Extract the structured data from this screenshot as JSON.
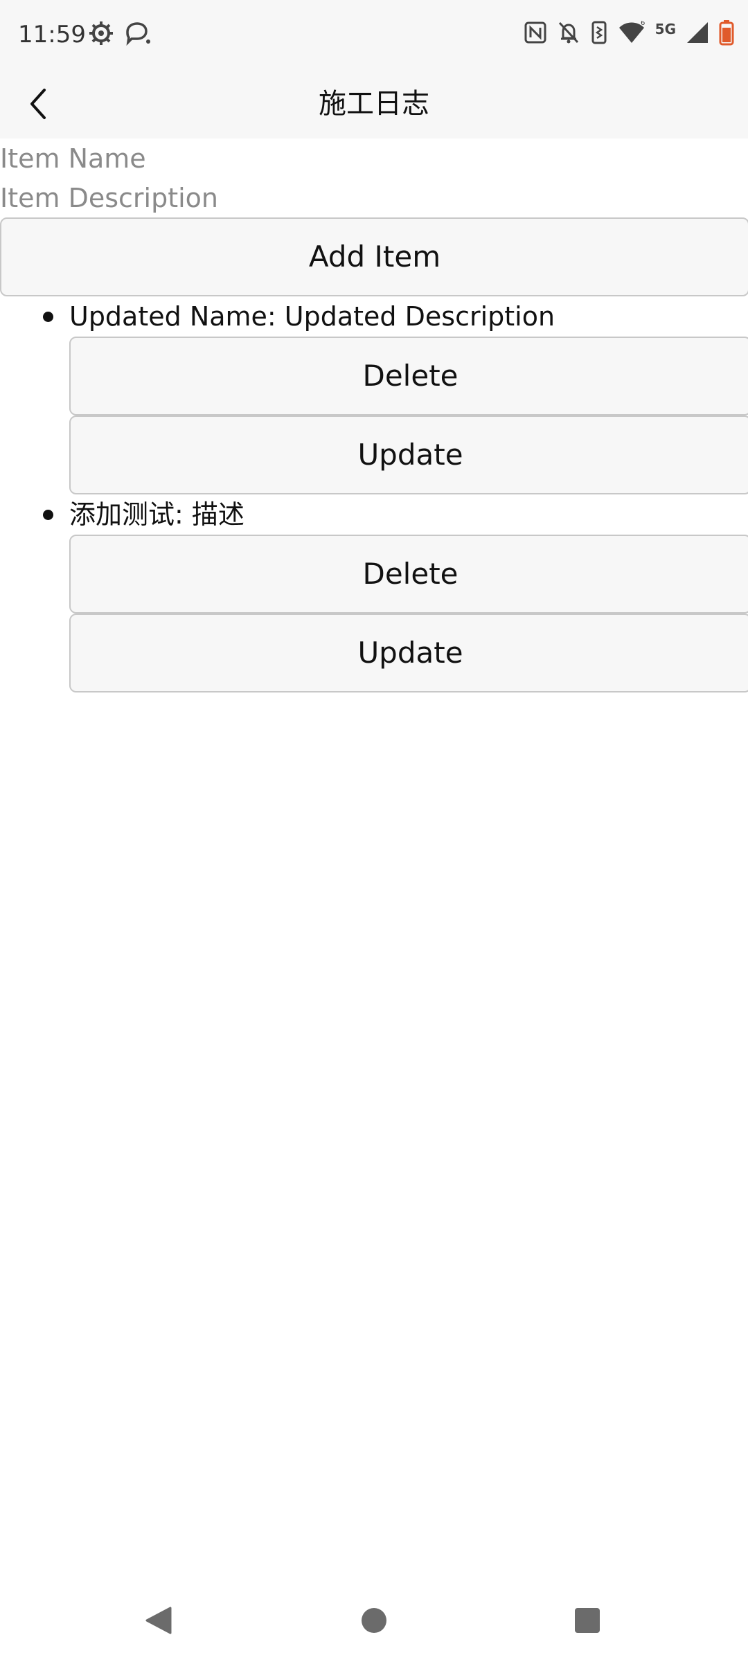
{
  "status_bar": {
    "time": "11:59",
    "network_label": "5G",
    "left_icons": [
      "settings-icon",
      "chat-bubble-icon"
    ],
    "right_icons": [
      "nfc-icon",
      "bell-off-icon",
      "vibrate-icon",
      "wifi-icon",
      "signal-icon",
      "battery-icon"
    ],
    "battery_color": "#e05a2b"
  },
  "app_bar": {
    "title": "施工日志",
    "back_icon": "chevron-left-icon"
  },
  "form": {
    "name_placeholder": "Item Name",
    "description_placeholder": "Item Description",
    "add_label": "Add Item"
  },
  "items": [
    {
      "text": "Updated Name: Updated Description",
      "delete_label": "Delete",
      "update_label": "Update"
    },
    {
      "text": "添加测试: 描述",
      "delete_label": "Delete",
      "update_label": "Update"
    }
  ],
  "nav_bar": {
    "icons": [
      "back-triangle-icon",
      "home-circle-icon",
      "recents-square-icon"
    ]
  }
}
